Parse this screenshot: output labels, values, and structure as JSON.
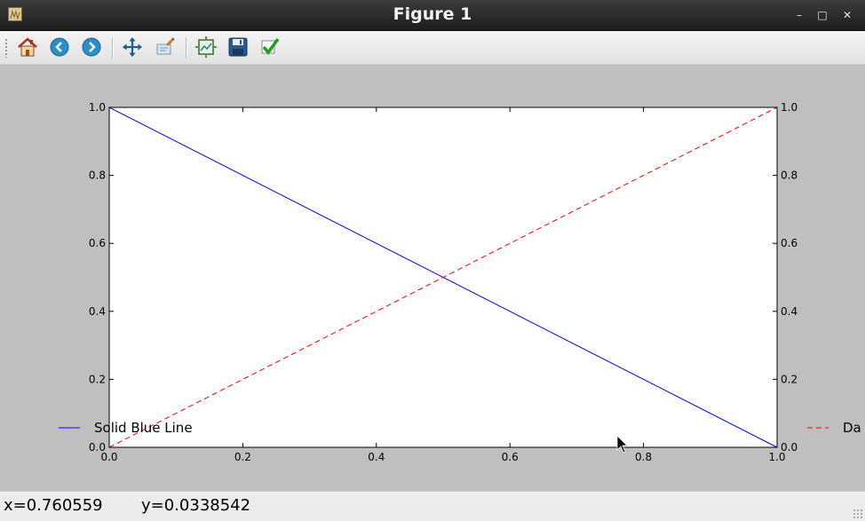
{
  "window": {
    "title": "Figure 1",
    "minimize_label": "–",
    "maximize_label": "□",
    "close_label": "✕"
  },
  "toolbar": {
    "buttons": [
      {
        "name": "home-icon"
      },
      {
        "name": "back-icon"
      },
      {
        "name": "forward-icon"
      },
      {
        "name": "pan-icon"
      },
      {
        "name": "zoom-icon"
      },
      {
        "name": "subplots-icon"
      },
      {
        "name": "save-icon"
      },
      {
        "name": "edit-axes-icon"
      }
    ]
  },
  "status": {
    "x_text": "x=0.760559",
    "y_text": "y=0.0338542"
  },
  "chart_data": {
    "type": "line",
    "title": "",
    "xlabel": "",
    "ylabel": "",
    "xlim": [
      0.0,
      1.0
    ],
    "ylim": [
      0.0,
      1.0
    ],
    "xticks": [
      "0.0",
      "0.2",
      "0.4",
      "0.6",
      "0.8",
      "1.0"
    ],
    "yticks": [
      "0.0",
      "0.2",
      "0.4",
      "0.6",
      "0.8",
      "1.0"
    ],
    "grid": false,
    "series": [
      {
        "name": "Solid Blue Line",
        "x": [
          0,
          1
        ],
        "y": [
          1,
          0
        ],
        "color": "#0000ff",
        "style": "solid",
        "axis": "left"
      },
      {
        "name": "Da",
        "x": [
          0,
          1
        ],
        "y": [
          0,
          1
        ],
        "color": "#ff0000",
        "style": "dashed",
        "axis": "right"
      }
    ]
  }
}
